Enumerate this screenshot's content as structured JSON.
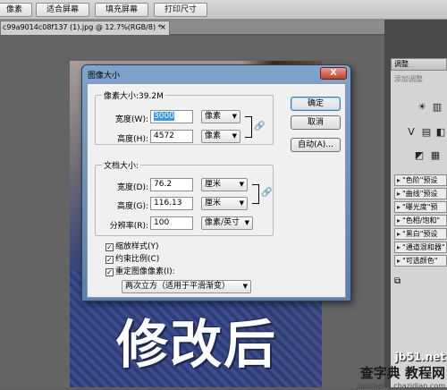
{
  "options_bar": {
    "buttons": [
      "像素",
      "适合屏幕",
      "填充屏幕",
      "打印尺寸"
    ]
  },
  "document_tab": {
    "title": "c99a9014c08f137 (1).jpg @ 12.7%(RGB/8) *",
    "close": "×"
  },
  "photo_caption": "修改后",
  "adjustments_panel": {
    "title": "调整",
    "add_label": "添加调整",
    "presets": [
      "\"色阶\"预设",
      "\"曲线\"预设",
      "\"曝光度\"预",
      "\"色相/饱和\"",
      "\"黑白\"预设",
      "\"通道混和器\"",
      "\"可选颜色\""
    ]
  },
  "watermark": {
    "site": "jb51.net",
    "text": "查字典 教程网",
    "url": "jiaocheng.chazidian.com"
  },
  "dialog": {
    "title": "图像大小",
    "close": "X",
    "pixel_group": {
      "label": "像素大小:39.2M",
      "width_label": "宽度(W):",
      "width_value": "3000",
      "width_unit": "像素",
      "height_label": "高度(H):",
      "height_value": "4572",
      "height_unit": "像素"
    },
    "doc_group": {
      "label": "文档大小:",
      "width_label": "宽度(D):",
      "width_value": "76.2",
      "width_unit": "厘米",
      "height_label": "高度(G):",
      "height_value": "116.13",
      "height_unit": "厘米",
      "res_label": "分辨率(R):",
      "res_value": "100",
      "res_unit": "像素/英寸"
    },
    "checkboxes": [
      {
        "label": "缩放样式(Y)",
        "checked": true
      },
      {
        "label": "约束比例(C)",
        "checked": true
      },
      {
        "label": "重定图像像素(I):",
        "checked": true
      }
    ],
    "resample_method": "两次立方（适用于平滑渐变）",
    "buttons": {
      "ok": "确定",
      "cancel": "取消",
      "auto": "自动(A)..."
    },
    "check_mark": "✓",
    "dropdown_arrow": "▼",
    "chain_icon": "🔗"
  }
}
